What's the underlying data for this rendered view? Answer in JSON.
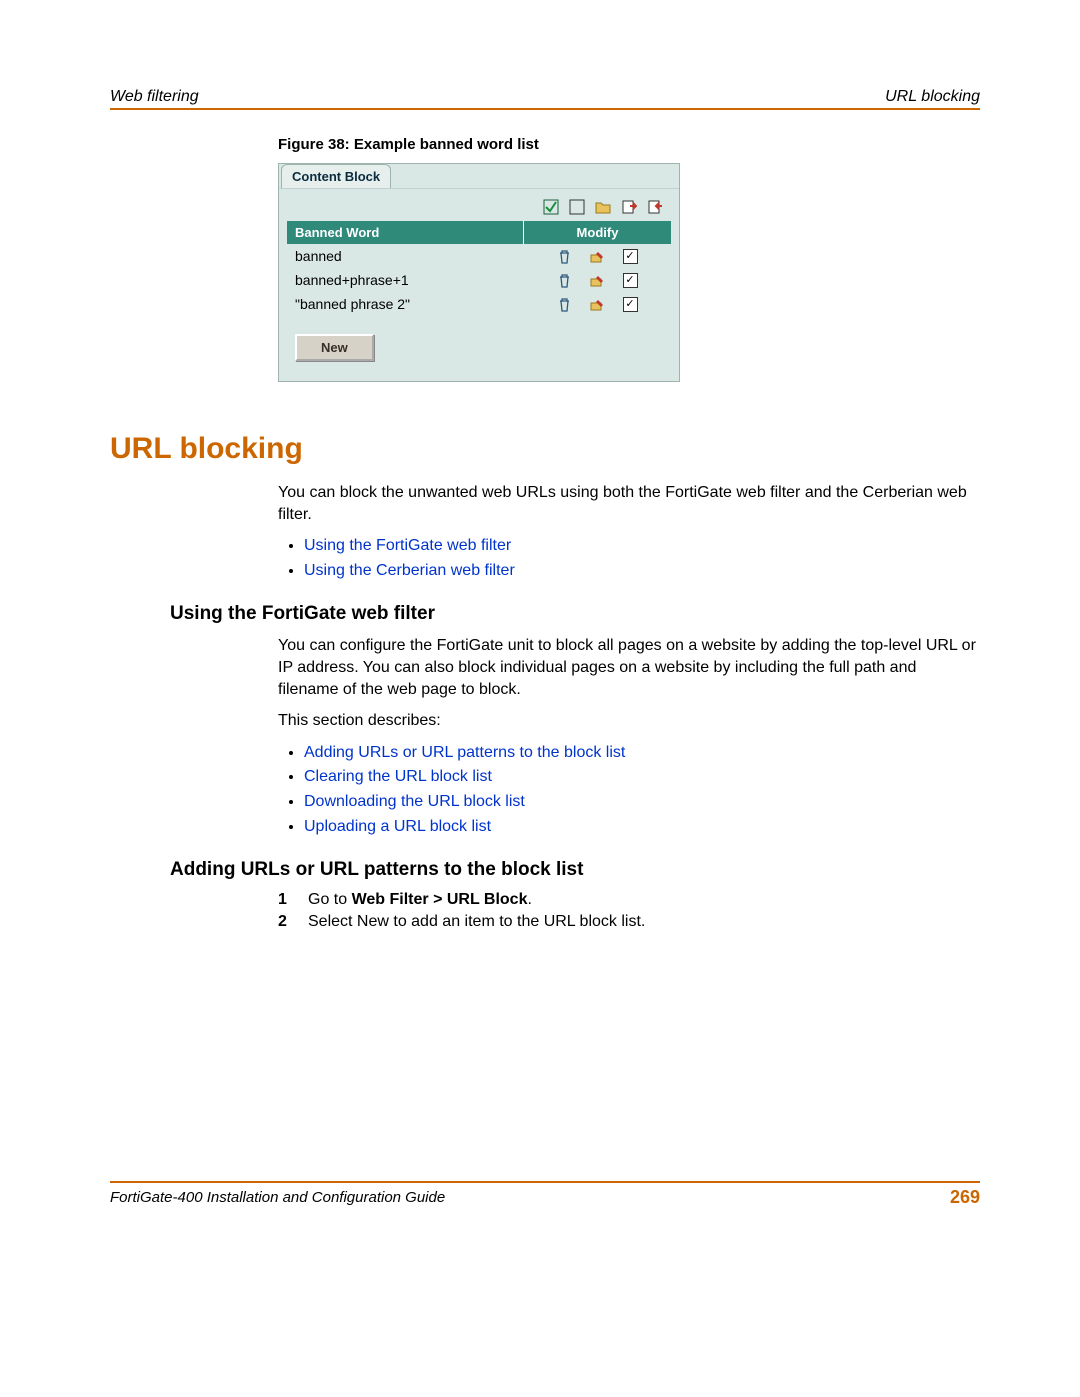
{
  "header": {
    "left": "Web filtering",
    "right": "URL blocking"
  },
  "figure": {
    "caption": "Figure 38: Example banned word list",
    "tab_label": "Content Block",
    "columns": {
      "word": "Banned Word",
      "modify": "Modify"
    },
    "rows": [
      {
        "word": "banned"
      },
      {
        "word": "banned+phrase+1"
      },
      {
        "word": "\"banned phrase 2\""
      }
    ],
    "new_button": "New"
  },
  "section": {
    "title": "URL blocking",
    "intro": "You can block the unwanted web URLs using both the FortiGate web filter and the Cerberian web filter.",
    "links_top": [
      "Using the FortiGate web filter",
      "Using the Cerberian web filter"
    ],
    "sub1_title": "Using the FortiGate web filter",
    "sub1_p": "You can configure the FortiGate unit to block all pages on a website by adding the top-level URL or IP address. You can also block individual pages on a website by including the full path and filename of the web page to block.",
    "sub1_p2": "This section describes:",
    "links_sub": [
      "Adding URLs or URL patterns to the block list",
      "Clearing the URL block list",
      "Downloading the URL block list",
      "Uploading a URL block list"
    ],
    "sub2_title": "Adding URLs or URL patterns to the block list",
    "steps": [
      {
        "n": "1",
        "prefix": "Go to ",
        "bold": "Web Filter > URL Block",
        "suffix": "."
      },
      {
        "n": "2",
        "prefix": "Select New to add an item to the URL block list.",
        "bold": "",
        "suffix": ""
      }
    ]
  },
  "footer": {
    "left": "FortiGate-400 Installation and Configuration Guide",
    "page": "269"
  }
}
